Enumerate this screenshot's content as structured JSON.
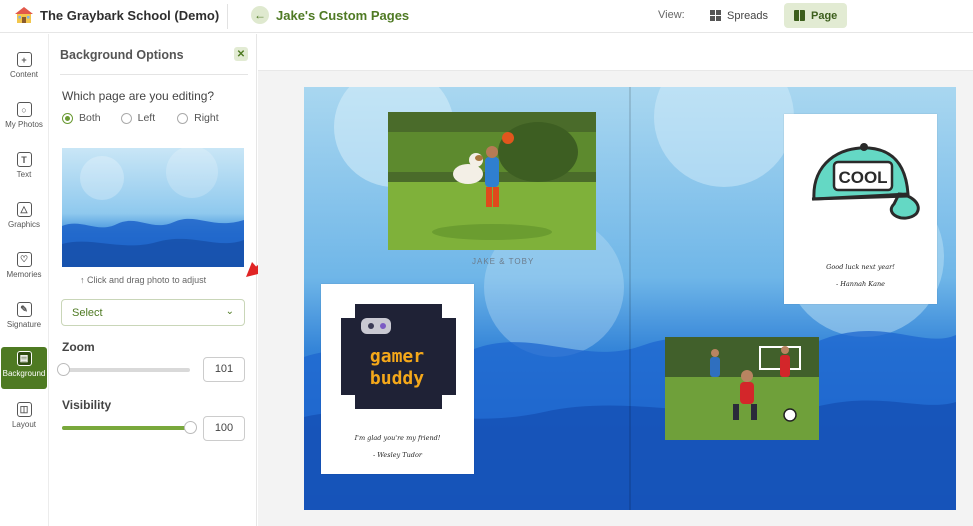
{
  "header": {
    "school_title": "The Graybark School (Demo)",
    "project_title": "Jake's Custom Pages",
    "view_label": "View:",
    "view_spreads": "Spreads",
    "view_page": "Page",
    "active_view": "Page"
  },
  "rail": {
    "items": [
      {
        "label": "Content",
        "icon": "plus-circle-icon"
      },
      {
        "label": "My Photos",
        "icon": "photos-icon"
      },
      {
        "label": "Text",
        "icon": "text-icon"
      },
      {
        "label": "Graphics",
        "icon": "shapes-icon"
      },
      {
        "label": "Memories",
        "icon": "memories-icon"
      },
      {
        "label": "Signature",
        "icon": "pen-icon"
      },
      {
        "label": "Background",
        "icon": "background-icon"
      },
      {
        "label": "Layout",
        "icon": "layout-icon"
      }
    ],
    "active": "Background"
  },
  "panel": {
    "title": "Background Options",
    "question": "Which page are you editing?",
    "radios": [
      "Both",
      "Left",
      "Right"
    ],
    "selected_radio": "Both",
    "hint": "Click and drag photo to adjust",
    "select_value": "Select",
    "zoom_label": "Zoom",
    "zoom_value": "101",
    "zoom_level": 0.01,
    "visibility_label": "Visibility",
    "visibility_value": "100",
    "visibility_level": 1.0
  },
  "spread": {
    "caption": "JAKE & TOBY",
    "left_card": {
      "graphic_text_1": "gamer",
      "graphic_text_2": "buddy",
      "message": "I'm glad you're my friend!",
      "signature": "- Wesley Tudor"
    },
    "right_card": {
      "graphic_text": "COOL",
      "message": "Good luck next year!",
      "signature": "- Hannah Kane"
    }
  },
  "colors": {
    "brand_green": "#4e7a22",
    "accent_light_green": "#e2ebd3",
    "watercolor_blue": "#1f6fcf"
  }
}
